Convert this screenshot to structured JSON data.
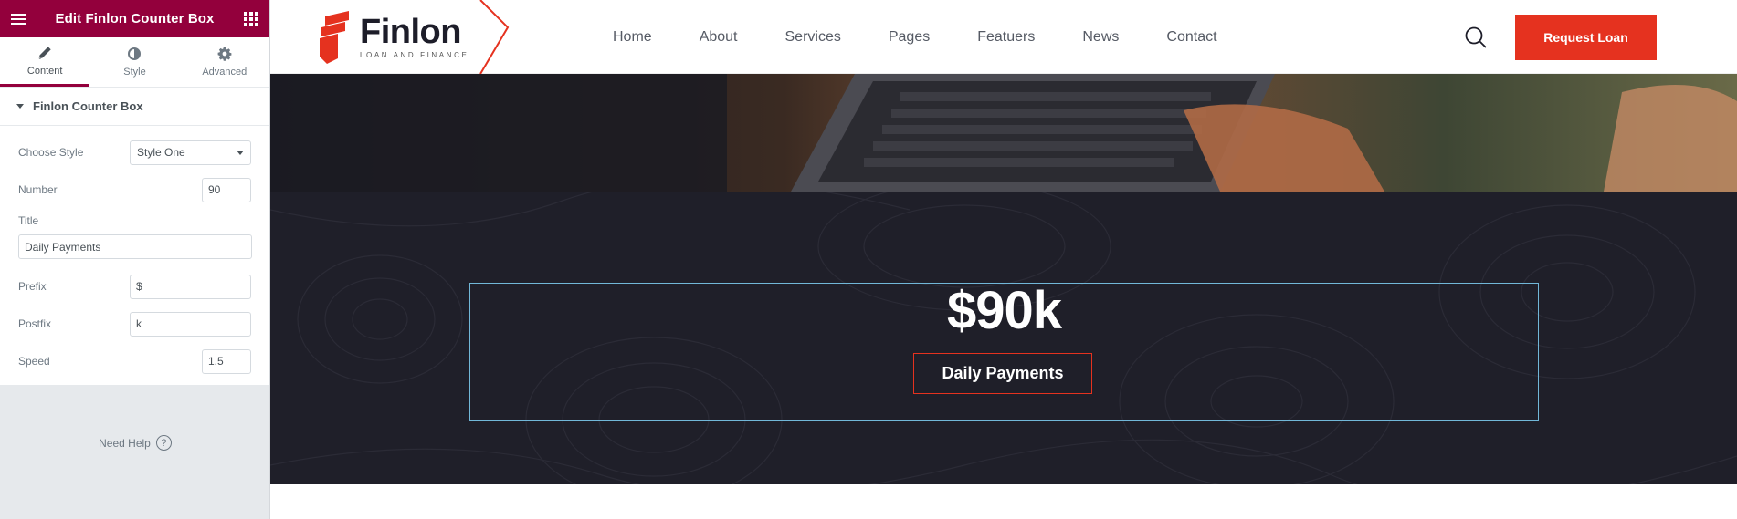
{
  "editor": {
    "header_title": "Edit Finlon Counter Box",
    "tabs": [
      {
        "label": "Content",
        "icon": "pencil-icon",
        "active": true
      },
      {
        "label": "Style",
        "icon": "contrast-icon",
        "active": false
      },
      {
        "label": "Advanced",
        "icon": "gear-icon",
        "active": false
      }
    ],
    "section_title": "Finlon Counter Box",
    "controls": {
      "choose_style_label": "Choose Style",
      "choose_style_value": "Style One",
      "number_label": "Number",
      "number_value": "90",
      "title_label": "Title",
      "title_value": "Daily Payments",
      "prefix_label": "Prefix",
      "prefix_value": "$",
      "postfix_label": "Postfix",
      "postfix_value": "k",
      "speed_label": "Speed",
      "speed_value": "1.5"
    },
    "need_help": "Need Help",
    "accent_color": "#93003c"
  },
  "site": {
    "logo": {
      "name": "Finlon",
      "tagline": "LOAN AND FINANCE"
    },
    "nav": [
      "Home",
      "About",
      "Services",
      "Pages",
      "Featuers",
      "News",
      "Contact"
    ],
    "cta_label": "Request Loan",
    "cta_color": "#e5321f"
  },
  "counter": {
    "display": "$90k",
    "title": "Daily Payments",
    "section_bg": "#1f1f29"
  }
}
